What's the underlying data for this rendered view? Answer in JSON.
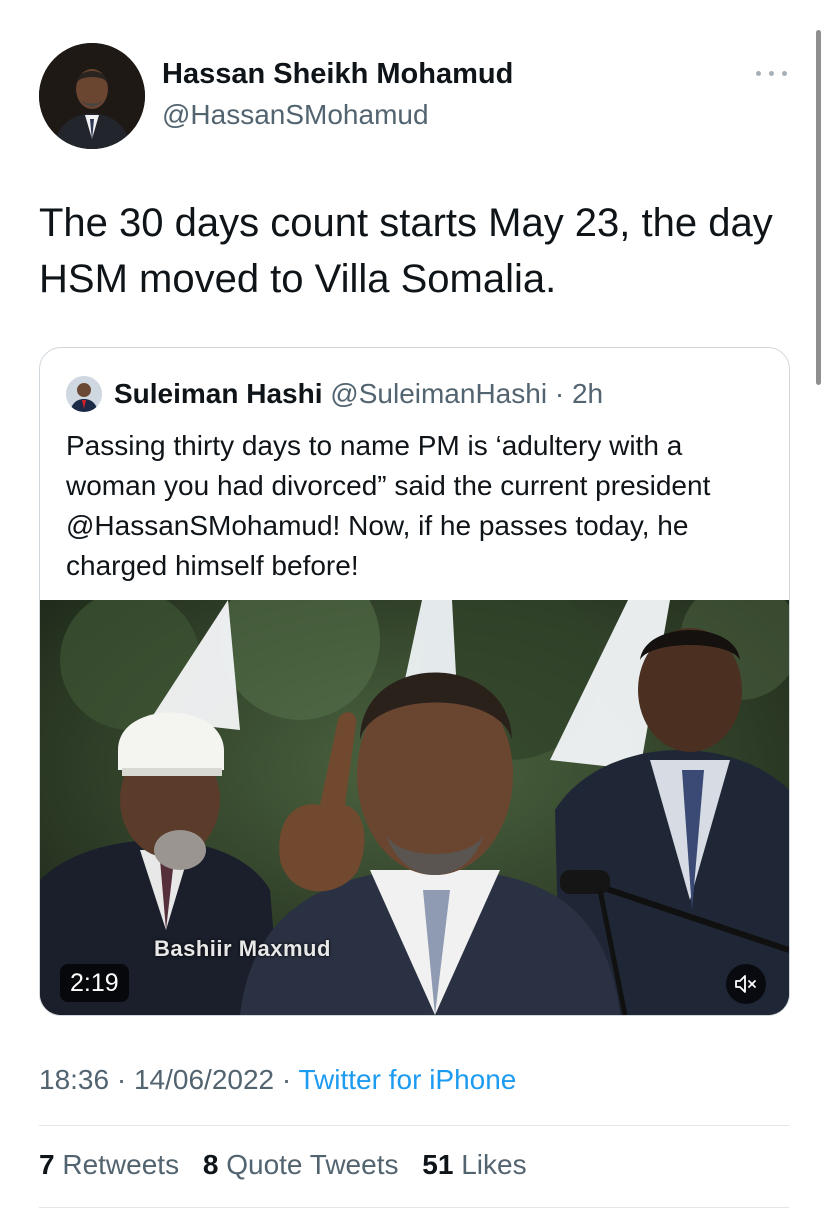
{
  "tweet": {
    "author": {
      "name": "Hassan Sheikh Mohamud",
      "handle": "@HassanSMohamud"
    },
    "text": "The 30 days count starts May 23, the day HSM moved to Villa Somalia.",
    "time": "18:36",
    "date": "14/06/2022",
    "source": "Twitter for iPhone",
    "stats": {
      "retweets_count": "7",
      "retweets_label": "Retweets",
      "quotes_count": "8",
      "quotes_label": "Quote Tweets",
      "likes_count": "51",
      "likes_label": "Likes"
    }
  },
  "quoted": {
    "name": "Suleiman Hashi",
    "handle": "@SuleimanHashi",
    "age": "2h",
    "text": "Passing thirty days to name PM is ‘adultery with a woman you had divorced” said the current president @HassanSMohamud! Now, if he passes today, he charged himself before!",
    "video": {
      "duration": "2:19",
      "watermark": "Bashiir Maxmud",
      "sound": "muted"
    }
  },
  "icons": {
    "more": "more-horizontal-icon",
    "mute": "speaker-muted-icon"
  },
  "colors": {
    "link": "#1d9bf0",
    "secondary_text": "#536471",
    "primary_text": "#0f1419"
  }
}
